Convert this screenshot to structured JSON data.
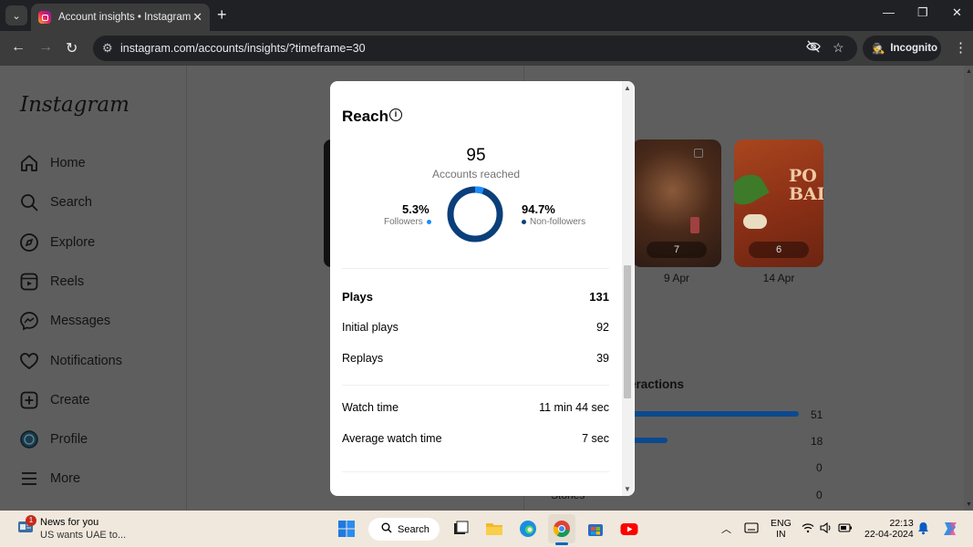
{
  "browser": {
    "tab_title": "Account insights • Instagram",
    "url": "instagram.com/accounts/insights/?timeframe=30",
    "incognito_label": "Incognito"
  },
  "sidebar": {
    "logo": "Instagram",
    "items": [
      {
        "label": "Home",
        "icon": "home-icon"
      },
      {
        "label": "Search",
        "icon": "search-icon"
      },
      {
        "label": "Explore",
        "icon": "compass-icon"
      },
      {
        "label": "Reels",
        "icon": "reels-icon"
      },
      {
        "label": "Messages",
        "icon": "messenger-icon"
      },
      {
        "label": "Notifications",
        "icon": "heart-icon"
      },
      {
        "label": "Create",
        "icon": "plus-square-icon"
      },
      {
        "label": "Profile",
        "icon": "avatar-icon"
      },
      {
        "label": "More",
        "icon": "hamburger-icon"
      }
    ]
  },
  "background": {
    "thumbs": [
      {
        "count": "7",
        "date": "9 Apr"
      },
      {
        "count": "6",
        "date": "14 Apr"
      }
    ],
    "interactions_heading": "eractions",
    "bar_values": [
      "51",
      "18",
      "0",
      "0"
    ],
    "stories_label": "Stories"
  },
  "modal": {
    "title": "Reach",
    "accounts_reached": "95",
    "accounts_reached_label": "Accounts reached",
    "followers_pct": "5.3%",
    "followers_label": "Followers",
    "nonfollowers_pct": "94.7%",
    "nonfollowers_label": "Non-followers",
    "followers_fraction": 0.053,
    "followers_color": "#1a8cff",
    "nonfollowers_color": "#0b3f7a",
    "plays_label": "Plays",
    "plays_value": "131",
    "initial_plays_label": "Initial plays",
    "initial_plays_value": "92",
    "replays_label": "Replays",
    "replays_value": "39",
    "watch_time_label": "Watch time",
    "watch_time_value": "11 min 44 sec",
    "avg_watch_time_label": "Average watch time",
    "avg_watch_time_value": "7 sec"
  },
  "taskbar": {
    "news_title": "News for you",
    "news_sub": "US wants UAE to...",
    "news_badge": "1",
    "search_label": "Search",
    "lang_line1": "ENG",
    "lang_line2": "IN",
    "time": "22:13",
    "date": "22-04-2024"
  }
}
